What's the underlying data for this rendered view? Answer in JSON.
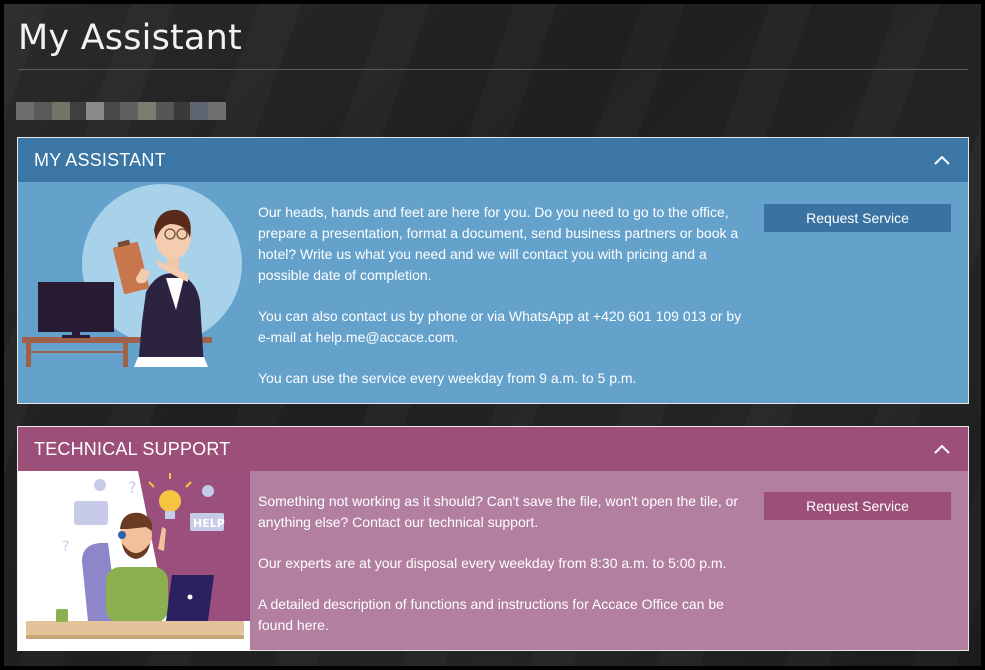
{
  "page": {
    "title": "My Assistant"
  },
  "colors": {
    "assistant_header": "#3b76a4",
    "assistant_body": "#64a2cc",
    "support_header": "#9c4f78",
    "support_body": "#b27fa0"
  },
  "panels": {
    "assistant": {
      "title": "MY ASSISTANT",
      "collapse_icon": "chevron-up-icon",
      "button_label": "Request Service",
      "paragraphs": [
        "Our heads, hands and feet are here for you. Do you need to go to the office, prepare a presentation, format a document, send business partners or book a hotel? Write us what you need and we will contact you with pricing and a possible date of completion.",
        "You can also contact us by phone or via WhatsApp at +420 601 109 013 or by e-mail at help.me@accace.com.",
        "You can use the service every weekday from 9 a.m. to 5 p.m."
      ],
      "illustration": "assistant-illustration-icon"
    },
    "support": {
      "title": "TECHNICAL SUPPORT",
      "collapse_icon": "chevron-up-icon",
      "button_label": "Request Service",
      "paragraphs": [
        "Something not working as it should? Can't save the file, won't open the tile, or anything else? Contact our technical support.",
        "Our experts are at your disposal every weekday from 8:30 a.m. to 5:00 p.m.",
        "A detailed description of functions and instructions for Accace Office can be found here."
      ],
      "help_sign": "HELP",
      "illustration": "support-illustration-icon"
    }
  }
}
